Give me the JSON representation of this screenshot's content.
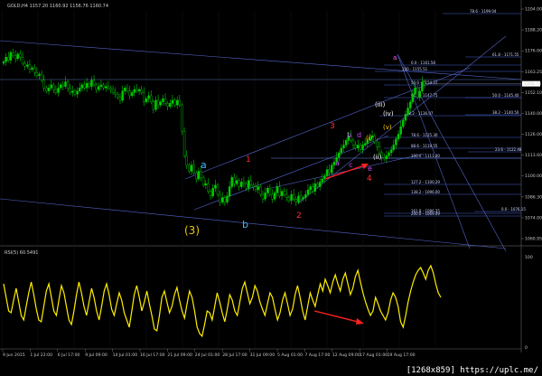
{
  "header": {
    "main_title": "GOLD,H4  1157.20 1160.92 1156.76 1160.74",
    "rsi_title": "RSI(5) 60.5491"
  },
  "colors": {
    "background": "#000000",
    "bull_candle": "#00cc00",
    "bear_candle": "#00cc00",
    "rsi_line": "#ffee00",
    "grid": "#1a1a1a",
    "trendline": "#5566cc",
    "fib": "#4a5fd0",
    "red_arrow": "#ff2020"
  },
  "price_axis": {
    "labels": [
      "1204.00",
      "1188.20",
      "1176.00",
      "1163.25",
      "1152.10",
      "1140.00",
      "1126.00",
      "1113.60",
      "1100.00",
      "1086.30",
      "1074.00",
      "1060.95"
    ]
  },
  "rsi_axis": {
    "labels": [
      "100",
      "0"
    ]
  },
  "time_axis": {
    "labels": [
      "9 Jun 2015",
      "1 Jul 22:00",
      "6 Jul 17:00",
      "9 Jul 09:00",
      "14 Jul 01:00",
      "16 Jul 17:00",
      "21 Jul 09:00",
      "24 Jul 01:00",
      "28 Jul 17:00",
      "31 Jul 09:00",
      "5 Aug 01:00",
      "7 Aug 17:00",
      "12 Aug 09:00",
      "17 Aug 01:00",
      "19 Aug 17:00"
    ]
  },
  "fib_labels": [
    "78.6 - 1199.04",
    "61.8 - 1171.55",
    "0.0 - 1161.58",
    "100 - 1155.51",
    "50.0 - 1154.22",
    "61.8 - 1147.75",
    "38.2 - 1136.07",
    "38.2 - 1140.50",
    "50.0 - 1145.40",
    "78.6 - 1125.30",
    "88.6 - 1119.55",
    "100.0 - 1111.40",
    "23.6 - 1122.48",
    "127.2 - 1100.29",
    "138.2 - 1096.00",
    "161.8 - 1086.35",
    "0.0 - 1076.15",
    "200.0 - 1069.49"
  ],
  "wave_labels": {
    "w3": "(3)",
    "a_blue": "a",
    "b_blue": "b",
    "red_1": "1",
    "red_2": "2",
    "red_3": "3",
    "red_4": "4",
    "a_m": "a",
    "b_m": "b",
    "c_m": "c",
    "d_m": "d",
    "e_m": "e",
    "i": "(i)",
    "ii": "(ii)",
    "iii": "(iii)",
    "iv": "(iv)",
    "v": "(v)",
    "top_a": "a"
  },
  "watermark": "[1268x859] https://uplc.me/",
  "chart_data": [
    {
      "type": "candlestick",
      "symbol": "GOLD",
      "timeframe": "H4",
      "last_ohlc": {
        "open": 1157.2,
        "high": 1160.92,
        "low": 1156.76,
        "close": 1160.74
      },
      "ylim": [
        1058,
        1208
      ],
      "closes": [
        1175,
        1178,
        1176,
        1181,
        1179,
        1177,
        1180,
        1178,
        1174,
        1172,
        1173,
        1170,
        1171,
        1168,
        1166,
        1167,
        1163,
        1158,
        1156,
        1158,
        1160,
        1157,
        1155,
        1158,
        1160,
        1159,
        1162,
        1158,
        1155,
        1156,
        1154,
        1156,
        1158,
        1160,
        1158,
        1161,
        1159,
        1163,
        1160,
        1157,
        1159,
        1160,
        1158,
        1159,
        1158,
        1157,
        1155,
        1154,
        1152,
        1150,
        1156,
        1158,
        1156,
        1153,
        1155,
        1157,
        1156,
        1157,
        1155,
        1149,
        1151,
        1153,
        1149,
        1144,
        1150,
        1147,
        1149,
        1151,
        1148,
        1146,
        1148,
        1150,
        1147,
        1150,
        1147,
        1130,
        1114,
        1108,
        1104,
        1108,
        1103,
        1099,
        1104,
        1100,
        1095,
        1096,
        1091,
        1088,
        1093,
        1095,
        1089,
        1084,
        1087,
        1084,
        1088,
        1094,
        1100,
        1096,
        1098,
        1094,
        1097,
        1096,
        1093,
        1098,
        1095,
        1094,
        1092,
        1094,
        1089,
        1086,
        1090,
        1093,
        1089,
        1086,
        1090,
        1094,
        1088,
        1091,
        1089,
        1087,
        1085,
        1089,
        1086,
        1084,
        1088,
        1086,
        1087,
        1089,
        1092,
        1094,
        1091,
        1096,
        1094,
        1097,
        1099,
        1101,
        1105,
        1103,
        1108,
        1110,
        1113,
        1116,
        1119,
        1121,
        1124,
        1127,
        1124,
        1121,
        1119,
        1121,
        1118,
        1121,
        1122,
        1124,
        1126,
        1127,
        1123,
        1120,
        1116,
        1113,
        1112,
        1114,
        1116,
        1118,
        1121,
        1125,
        1128,
        1133,
        1137,
        1141,
        1145,
        1149,
        1154,
        1158,
        1152,
        1156,
        1162,
        1160
      ]
    },
    {
      "type": "line",
      "name": "RSI(5)",
      "ylim": [
        0,
        100
      ],
      "values": [
        70,
        55,
        40,
        38,
        52,
        65,
        50,
        35,
        30,
        45,
        60,
        72,
        58,
        42,
        30,
        28,
        45,
        62,
        70,
        55,
        40,
        35,
        52,
        68,
        60,
        45,
        30,
        25,
        40,
        58,
        72,
        60,
        45,
        35,
        50,
        65,
        55,
        40,
        30,
        45,
        62,
        70,
        58,
        42,
        35,
        48,
        60,
        52,
        38,
        30,
        22,
        40,
        58,
        68,
        55,
        40,
        50,
        62,
        48,
        35,
        20,
        18,
        35,
        55,
        62,
        50,
        38,
        45,
        58,
        66,
        52,
        40,
        32,
        48,
        62,
        55,
        40,
        22,
        15,
        12,
        25,
        40,
        38,
        30,
        45,
        60,
        50,
        38,
        28,
        42,
        58,
        52,
        40,
        35,
        50,
        65,
        72,
        60,
        48,
        55,
        68,
        62,
        50,
        42,
        35,
        48,
        60,
        55,
        42,
        30,
        38,
        52,
        60,
        48,
        35,
        42,
        58,
        68,
        55,
        40,
        30,
        45,
        60,
        52,
        45,
        58,
        70,
        62,
        75,
        68,
        60,
        72,
        80,
        70,
        62,
        75,
        82,
        70,
        58,
        65,
        78,
        85,
        72,
        60,
        50,
        42,
        35,
        40,
        55,
        48,
        40,
        35,
        30,
        38,
        52,
        60,
        55,
        45,
        28,
        22,
        35,
        50,
        62,
        72,
        80,
        85,
        88,
        82,
        75,
        85,
        90,
        82,
        70,
        60,
        55
      ]
    }
  ]
}
